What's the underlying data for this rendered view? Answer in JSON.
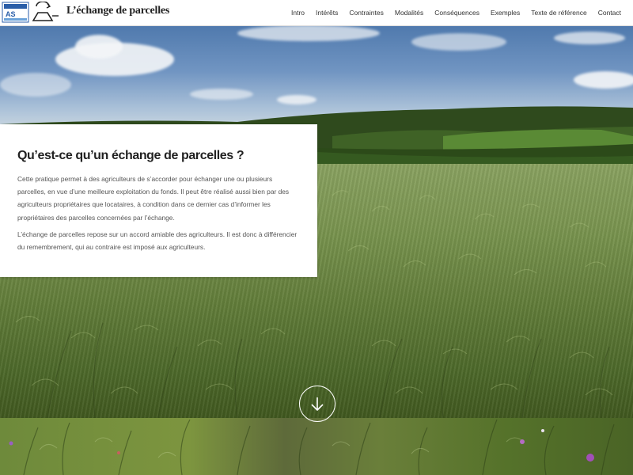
{
  "header": {
    "logo_alt": "logo",
    "site_title": "L’échange de parcelles"
  },
  "nav": {
    "items": [
      {
        "label": "Intro"
      },
      {
        "label": "Intérêts"
      },
      {
        "label": "Contraintes"
      },
      {
        "label": "Modalités"
      },
      {
        "label": "Conséquences"
      },
      {
        "label": "Exemples"
      },
      {
        "label": "Texte de référence"
      },
      {
        "label": "Contact"
      }
    ]
  },
  "intro": {
    "title": "Qu’est-ce qu’un échange de parcelles ?",
    "paragraph1": "Cette pratique permet à des agriculteurs de s’accorder pour échanger une ou plusieurs parcelles, en vue d’une meilleure exploitation du fonds. Il peut être réalisé aussi bien par des agriculteurs propriétaires que locataires, à condition dans ce dernier cas d’informer les propriétaires des parcelles concernées par l’échange.",
    "paragraph2": "L’échange de parcelles repose sur un accord amiable des agriculteurs. Il est donc à différencier du remembrement, qui au contraire est imposé aux agriculteurs."
  },
  "icons": {
    "scroll": "arrow-down-icon",
    "logo": "logo-icon"
  },
  "colors": {
    "nav_bg": "#ffffff",
    "card_bg": "#ffffff",
    "text_dark": "#222222",
    "text_body": "#555555"
  }
}
